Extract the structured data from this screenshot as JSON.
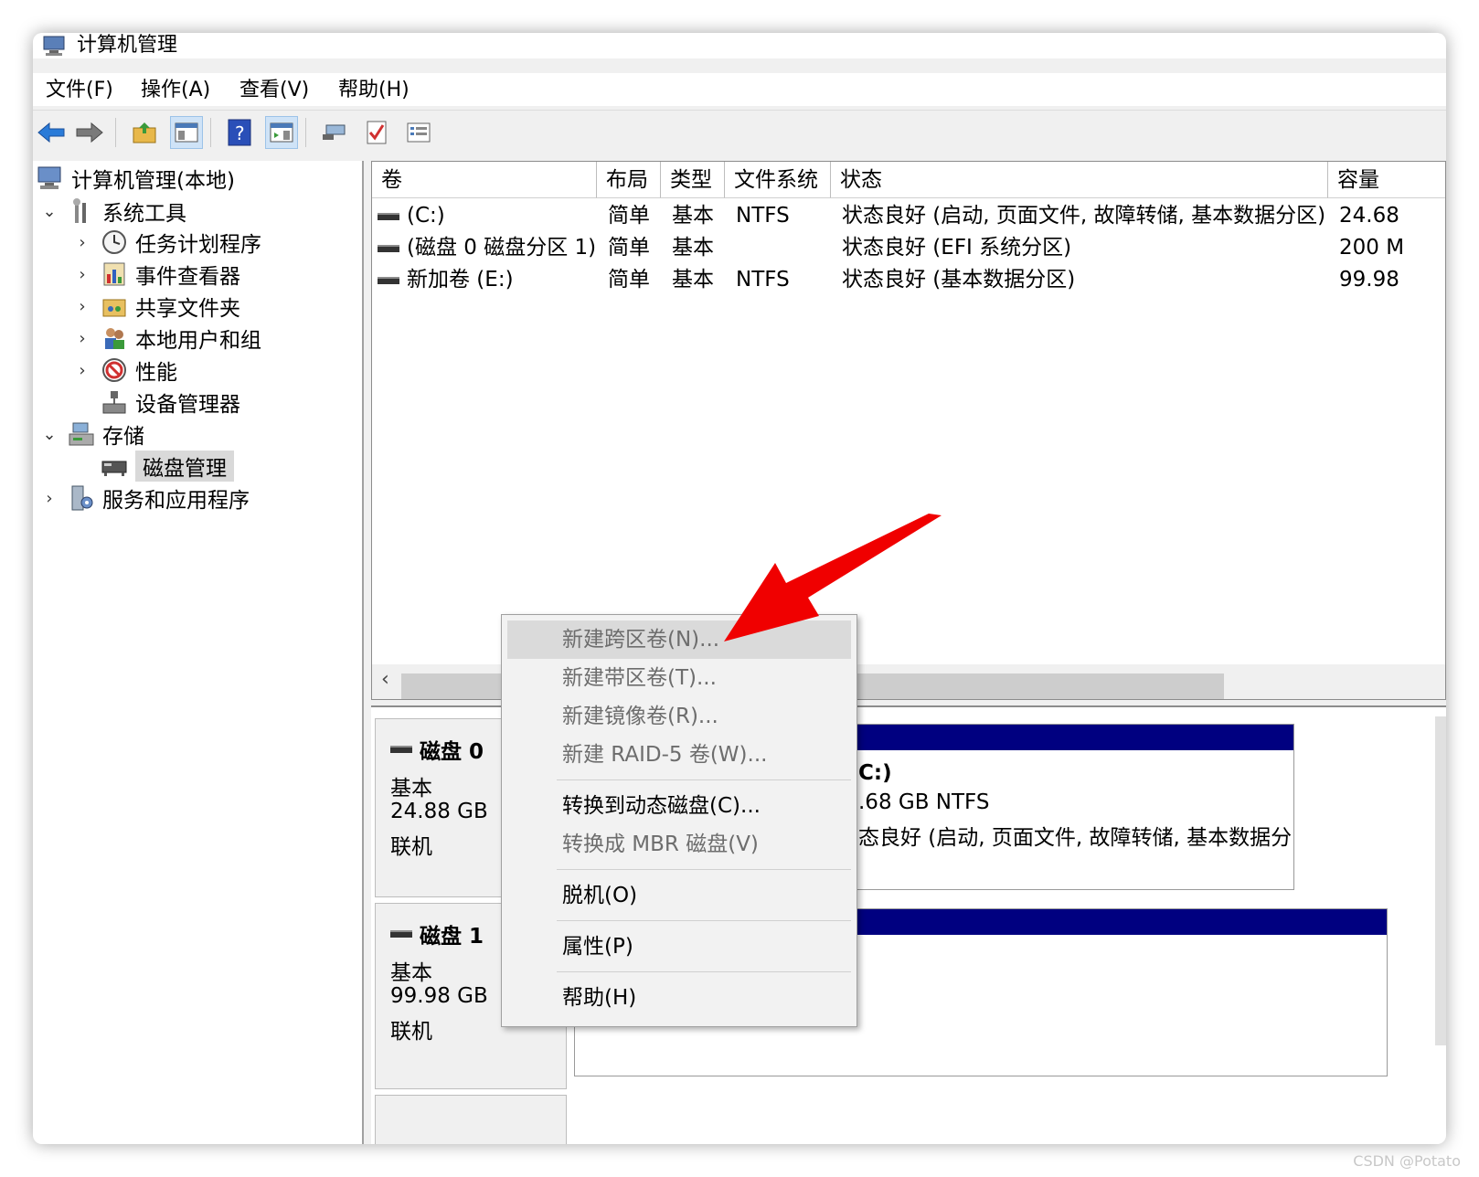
{
  "window": {
    "title": "计算机管理"
  },
  "menu": [
    "文件(F)",
    "操作(A)",
    "查看(V)",
    "帮助(H)"
  ],
  "toolbar": {
    "buttons": [
      "back-icon",
      "forward-icon",
      "up-folder-icon",
      "show-hide-tree-icon",
      "help-icon",
      "action-pane-icon",
      "connect-icon",
      "check-icon",
      "list-icon"
    ]
  },
  "tree": {
    "root": "计算机管理(本地)",
    "system_tools": "系统工具",
    "task_scheduler": "任务计划程序",
    "event_viewer": "事件查看器",
    "shared_folders": "共享文件夹",
    "local_users": "本地用户和组",
    "performance": "性能",
    "device_manager": "设备管理器",
    "storage": "存储",
    "disk_management": "磁盘管理",
    "services_apps": "服务和应用程序"
  },
  "volumes": {
    "headers": [
      "卷",
      "布局",
      "类型",
      "文件系统",
      "状态",
      "容量"
    ],
    "rows": [
      {
        "vol": "(C:)",
        "layout": "简单",
        "type": "基本",
        "fs": "NTFS",
        "status": "状态良好 (启动, 页面文件, 故障转储, 基本数据分区)",
        "capacity": "24.68"
      },
      {
        "vol": "(磁盘 0 磁盘分区 1)",
        "layout": "简单",
        "type": "基本",
        "fs": "",
        "status": "状态良好 (EFI 系统分区)",
        "capacity": "200 M"
      },
      {
        "vol": "新加卷 (E:)",
        "layout": "简单",
        "type": "基本",
        "fs": "NTFS",
        "status": "状态良好 (基本数据分区)",
        "capacity": "99.98"
      }
    ]
  },
  "disks": [
    {
      "name": "磁盘 0",
      "type": "基本",
      "size": "24.88 GB",
      "state": "联机"
    },
    {
      "name": "磁盘 1",
      "type": "基本",
      "size": "99.98 GB",
      "state": "联机"
    }
  ],
  "partition_c": {
    "name": "C:)",
    "size": ".68 GB NTFS",
    "status": "态良好 (启动, 页面文件, 故障转储, 基本数据分"
  },
  "context_menu": {
    "new_spanned": "新建跨区卷(N)...",
    "new_striped": "新建带区卷(T)...",
    "new_mirrored": "新建镜像卷(R)...",
    "new_raid5": "新建 RAID-5 卷(W)...",
    "convert_dynamic": "转换到动态磁盘(C)...",
    "convert_mbr": "转换成 MBR 磁盘(V)",
    "offline": "脱机(O)",
    "properties": "属性(P)",
    "help": "帮助(H)"
  },
  "watermark": "CSDN @Potato"
}
